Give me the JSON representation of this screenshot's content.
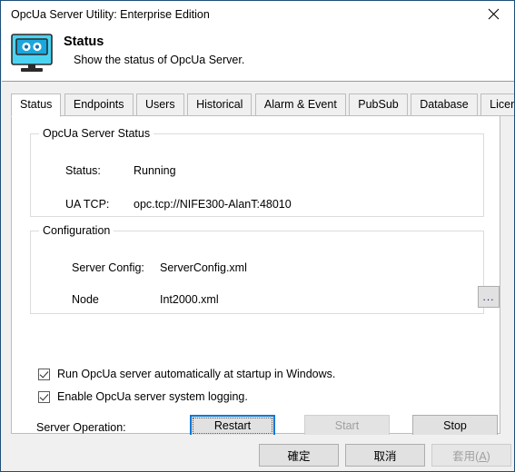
{
  "window": {
    "title": "OpcUa Server Utility: Enterprise Edition",
    "close_icon": "close-icon"
  },
  "header": {
    "icon": "monitor-status-icon",
    "title": "Status",
    "subtitle": "Show the status of OpcUa Server."
  },
  "tabs": [
    {
      "label": "Status",
      "active": true
    },
    {
      "label": "Endpoints",
      "active": false
    },
    {
      "label": "Users",
      "active": false
    },
    {
      "label": "Historical",
      "active": false
    },
    {
      "label": "Alarm & Event",
      "active": false
    },
    {
      "label": "PubSub",
      "active": false
    },
    {
      "label": "Database",
      "active": false
    },
    {
      "label": "License",
      "active": false
    }
  ],
  "status_group": {
    "legend": "OpcUa Server Status",
    "status_label": "Status:",
    "status_value": "Running",
    "uatcp_label": "UA TCP:",
    "uatcp_value": "opc.tcp://NIFE300-AlanT:48010"
  },
  "config_group": {
    "legend": "Configuration",
    "server_config_label": "Server Config:",
    "server_config_value": "ServerConfig.xml",
    "node_label": "Node",
    "node_value": "Int2000.xml",
    "browse_label": "..."
  },
  "options": {
    "autostart_label": "Run OpcUa server automatically at startup in Windows.",
    "autostart_checked": true,
    "logging_label": "Enable OpcUa server system logging.",
    "logging_checked": true
  },
  "server_operation": {
    "label": "Server Operation:",
    "restart_label": "Restart",
    "restart_focused": true,
    "start_label": "Start",
    "start_disabled": true,
    "stop_label": "Stop",
    "stop_disabled": false
  },
  "footer": {
    "ok_label": "確定",
    "cancel_label": "取消",
    "apply_label": "套用(A)",
    "apply_accel": "A",
    "apply_disabled": true
  },
  "colors": {
    "window_border": "#1f4e79",
    "dialog_bg": "#f0f0f0",
    "panel_bg": "#ffffff",
    "focus_accent": "#0078d7",
    "icon_screen": "#4cd3f2",
    "icon_frame": "#1a9fd4",
    "disabled_text": "#a0a0a0"
  }
}
